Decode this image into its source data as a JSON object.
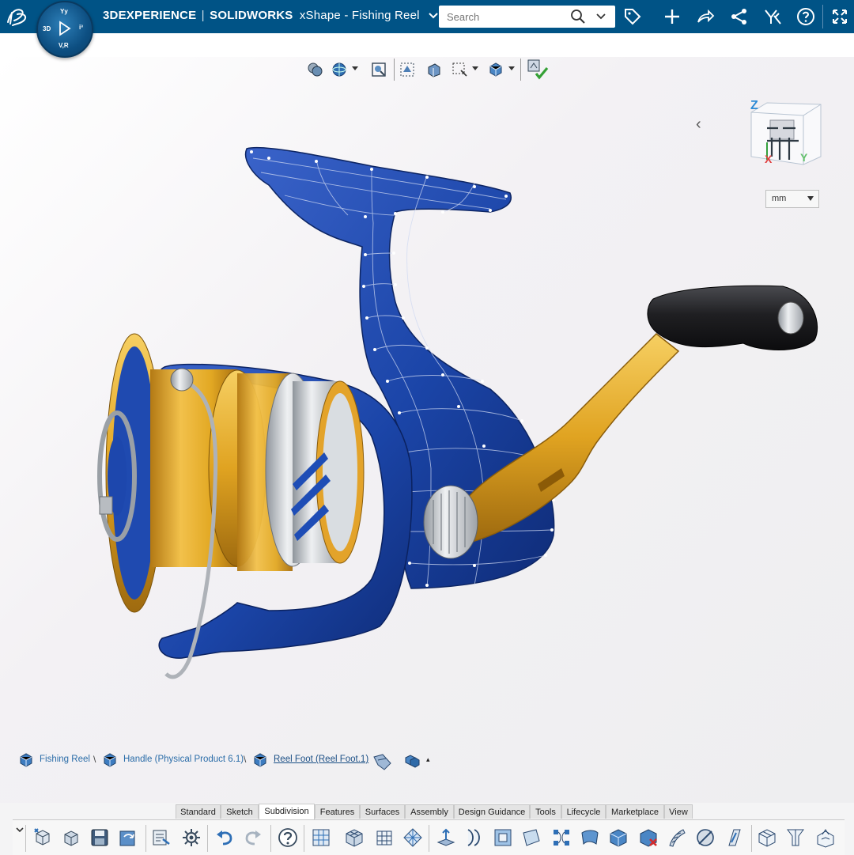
{
  "app": {
    "brand": "3DEXPERIENCE",
    "separator": "|",
    "product": "SOLIDWORKS",
    "app_name": "xShape",
    "separator2": "-",
    "document": "Fishing Reel"
  },
  "compass": {
    "top": "Yy",
    "left": "3D",
    "right": "i³",
    "bottom": "V,R"
  },
  "search": {
    "placeholder": "Search"
  },
  "topbar_icons": [
    "tag-icon",
    "plus-icon",
    "share-icon",
    "network-icon",
    "collaborate-icon",
    "help-icon",
    "fullscreen-icon"
  ],
  "view_toolbar": [
    "display-style-icon",
    "render-icon",
    "zoom-fit-icon",
    "view-selector-icon",
    "section-icon",
    "box-select-icon",
    "view-cube-icon",
    "manipulator-ok-icon"
  ],
  "orientation_cube": {
    "z_label": "Z",
    "x_label": "X",
    "y_label": "Y"
  },
  "units": {
    "selected": "mm"
  },
  "breadcrumb": [
    {
      "label": "Fishing Reel"
    },
    {
      "label": "Handle (Physical Product 6.1)"
    },
    {
      "label": "Reel Foot (Reel Foot.1)"
    }
  ],
  "breadcrumb_sep": "\\",
  "breadcrumb_more": "▴",
  "tabs": [
    {
      "label": "Standard"
    },
    {
      "label": "Sketch"
    },
    {
      "label": "Subdivision",
      "active": true
    },
    {
      "label": "Features"
    },
    {
      "label": "Surfaces"
    },
    {
      "label": "Assembly"
    },
    {
      "label": "Design Guidance"
    },
    {
      "label": "Tools"
    },
    {
      "label": "Lifecycle"
    },
    {
      "label": "Marketplace"
    },
    {
      "label": "View"
    }
  ],
  "action_icons": [
    "new-part-icon",
    "open-icon",
    "save-icon",
    "save-all-icon",
    "properties-icon",
    "settings-icon",
    "undo-icon",
    "redo-icon",
    "help-icon",
    "subdivision-icon",
    "primitive-box-icon",
    "grid-icon",
    "mesh-icon",
    "extrude-face-icon",
    "edge-loop-icon",
    "frame-icon",
    "face-icon",
    "bridge-icon",
    "surface-icon",
    "solid-icon",
    "delete-face-icon",
    "bend-icon",
    "symmetry-icon",
    "slice-icon",
    "cube-icon",
    "mirror-icon",
    "convert-icon"
  ],
  "colors": {
    "topbar": "#005386",
    "reel_blue": "#1b45a8",
    "gold": "#e2a823",
    "silver": "#c9ccd1",
    "knob": "#1f1f22"
  }
}
